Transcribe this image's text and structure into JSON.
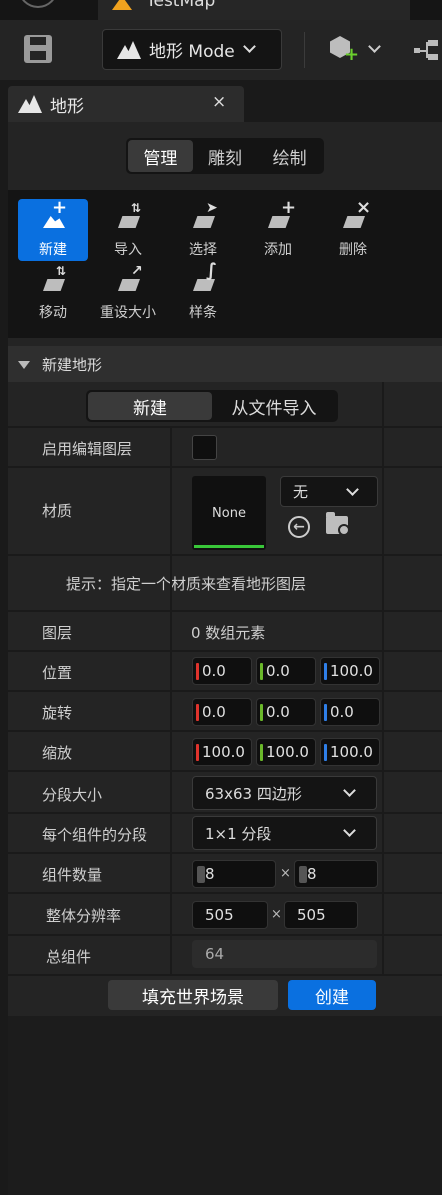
{
  "header": {
    "tab_title": "TestMap"
  },
  "toolbar": {
    "mode_label": "地形 Mode"
  },
  "panel": {
    "title": "地形",
    "close": "×"
  },
  "mode_tabs": [
    {
      "label": "管理"
    },
    {
      "label": "雕刻"
    },
    {
      "label": "绘制"
    }
  ],
  "tools": [
    {
      "label": "新建",
      "sym": "+"
    },
    {
      "label": "导入",
      "sym": "⇅"
    },
    {
      "label": "选择",
      "sym": "➤"
    },
    {
      "label": "添加",
      "sym": "+"
    },
    {
      "label": "删除",
      "sym": "×"
    },
    {
      "label": "移动",
      "sym": "⇅"
    },
    {
      "label": "重设大小",
      "sym": "↗"
    },
    {
      "label": "样条",
      "sym": "∫"
    }
  ],
  "section": {
    "title": "新建地形"
  },
  "create_tabs": [
    {
      "label": "新建"
    },
    {
      "label": "从文件导入"
    }
  ],
  "fields": {
    "edit_layers": "启用编辑图层",
    "material": "材质",
    "material_value": "None",
    "material_dropdown": "无",
    "hint": "提示：指定一个材质来查看地形图层",
    "layers": "图层",
    "layers_value": "0 数组元素",
    "location": "位置",
    "location_values": [
      "0.0",
      "0.0",
      "100.0"
    ],
    "rotation": "旋转",
    "rotation_values": [
      "0.0",
      "0.0",
      "0.0"
    ],
    "scale": "缩放",
    "scale_values": [
      "100.0",
      "100.0",
      "100.0"
    ],
    "section_size": "分段大小",
    "section_size_value": "63x63 四边形",
    "sections_per_component": "每个组件的分段",
    "sections_per_component_value": "1×1 分段",
    "component_count": "组件数量",
    "component_count_values": [
      "8",
      "8"
    ],
    "overall_resolution": "整体分辨率",
    "overall_resolution_values": [
      "505",
      "505"
    ],
    "total_components": "总组件",
    "total_components_value": "64",
    "times": "×"
  },
  "actions": {
    "fill_world": "填充世界场景",
    "create": "创建"
  },
  "colors": {
    "accent": "#0a70e0",
    "x_axis": "#e0332c",
    "y_axis": "#6ab82a",
    "z_axis": "#2f7fe8",
    "material_ok": "#39c739"
  }
}
